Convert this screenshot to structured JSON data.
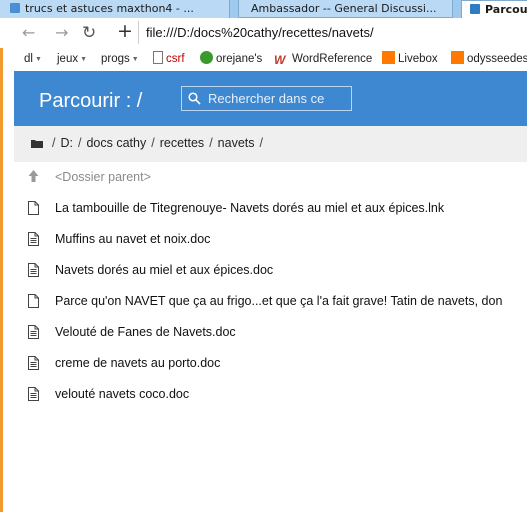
{
  "tabs": [
    {
      "label": "trucs et astuces maxthon4 - ..."
    },
    {
      "label": "Ambassador -- General Discussi..."
    },
    {
      "label": "Parcourir"
    }
  ],
  "address_bar": {
    "url": "file:///D:/docs%20cathy/recettes/navets/"
  },
  "bookmarks": [
    {
      "label": "dl"
    },
    {
      "label": "jeux"
    },
    {
      "label": "progs"
    },
    {
      "label": "csrf"
    },
    {
      "label": "orejane's"
    },
    {
      "label": "WordReference"
    },
    {
      "label": "Livebox"
    },
    {
      "label": "odysseedes"
    }
  ],
  "header": {
    "title": "Parcourir : /",
    "search_placeholder": "Rechercher dans ce"
  },
  "breadcrumb": [
    "D:",
    "docs cathy",
    "recettes",
    "navets"
  ],
  "file_list": {
    "parent": "<Dossier parent>",
    "items": [
      {
        "name": "La tambouille de Titegrenouye- Navets dorés au miel et aux épices.lnk",
        "icon": "file-icon"
      },
      {
        "name": "Muffins au navet et noix.doc",
        "icon": "document-icon"
      },
      {
        "name": "Navets dorés au miel et aux épices.doc",
        "icon": "document-icon"
      },
      {
        "name": "Parce qu'on NAVET que ça au frigo...et que ça l'a fait grave! Tatin de navets, don",
        "icon": "file-icon"
      },
      {
        "name": "Velouté de Fanes de Navets.doc",
        "icon": "document-icon"
      },
      {
        "name": "creme de navets au porto.doc",
        "icon": "document-icon"
      },
      {
        "name": "velouté navets coco.doc",
        "icon": "document-icon"
      }
    ]
  }
}
